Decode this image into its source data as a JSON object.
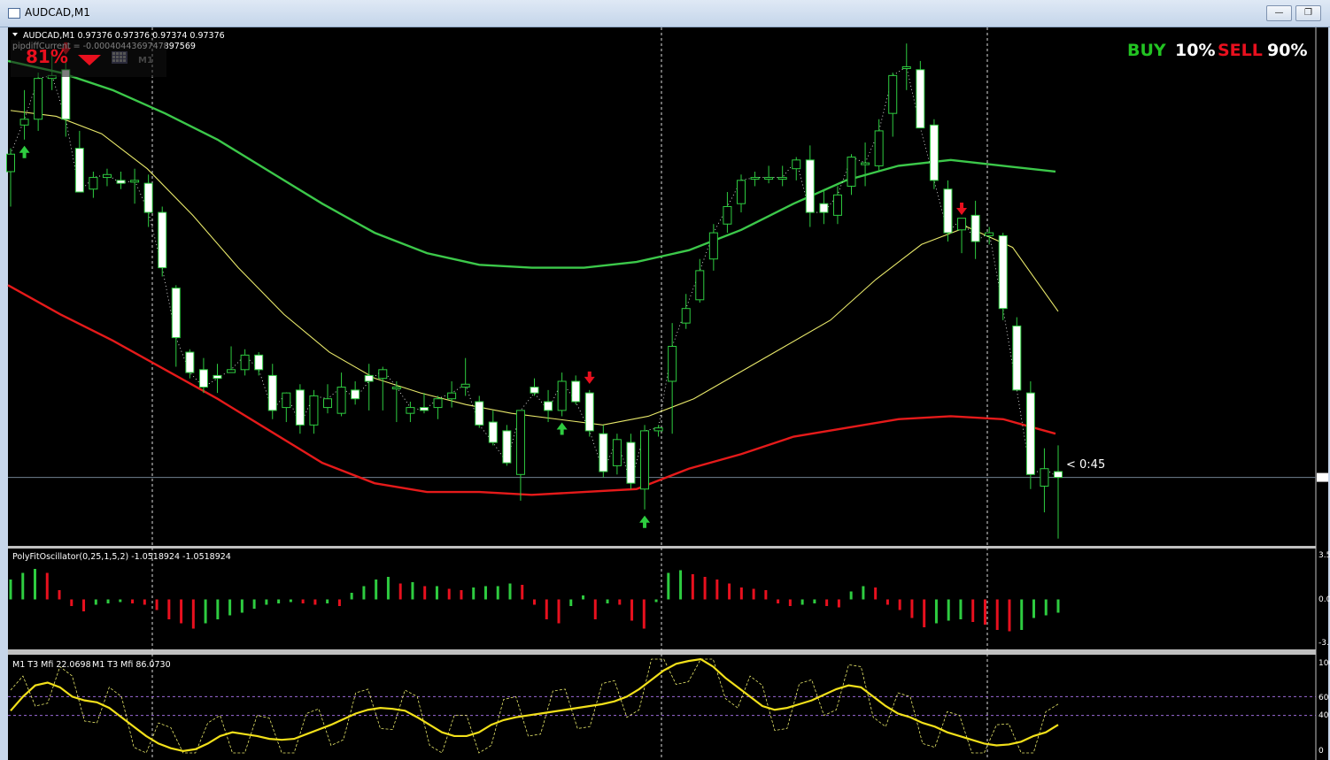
{
  "window": {
    "title": "AUDCAD,M1"
  },
  "main": {
    "info_line": "AUDCAD,M1  0.97376 0.97376 0.97374 0.97376",
    "pipdiff": "pipdiffCurrent = -0.0004044369747897569",
    "percent": "81%",
    "signal": {
      "buy_label": "BUY",
      "buy_value": "10%",
      "sell_label": "SELL",
      "sell_value": "90%"
    },
    "countdown": "< 0:45",
    "candles": [
      [
        0.9752,
        0.976,
        0.974,
        0.9758
      ],
      [
        0.9768,
        0.978,
        0.9763,
        0.977
      ],
      [
        0.977,
        0.9786,
        0.9766,
        0.9784
      ],
      [
        0.9784,
        0.9792,
        0.978,
        0.9785
      ],
      [
        0.9787,
        0.979,
        0.9764,
        0.977
      ],
      [
        0.976,
        0.9766,
        0.9746,
        0.9745
      ],
      [
        0.9746,
        0.9752,
        0.9743,
        0.975
      ],
      [
        0.975,
        0.9753,
        0.9747,
        0.9751
      ],
      [
        0.9749,
        0.9752,
        0.9746,
        0.9748
      ],
      [
        0.9749,
        0.9753,
        0.9741,
        0.9749
      ],
      [
        0.9748,
        0.9751,
        0.9733,
        0.9738
      ],
      [
        0.9738,
        0.974,
        0.9716,
        0.9719
      ],
      [
        0.9712,
        0.9713,
        0.9685,
        0.9695
      ],
      [
        0.969,
        0.9691,
        0.9681,
        0.9683
      ],
      [
        0.9684,
        0.9688,
        0.9676,
        0.9678
      ],
      [
        0.9682,
        0.9686,
        0.9676,
        0.9681
      ],
      [
        0.9683,
        0.9692,
        0.9683,
        0.9684
      ],
      [
        0.9684,
        0.9691,
        0.9682,
        0.9689
      ],
      [
        0.9689,
        0.969,
        0.9682,
        0.9684
      ],
      [
        0.9682,
        0.9686,
        0.9667,
        0.967
      ],
      [
        0.9671,
        0.9676,
        0.9666,
        0.9676
      ],
      [
        0.9677,
        0.9679,
        0.9662,
        0.9665
      ],
      [
        0.9665,
        0.9677,
        0.9662,
        0.9675
      ],
      [
        0.9671,
        0.9679,
        0.9669,
        0.9674
      ],
      [
        0.9669,
        0.9683,
        0.9668,
        0.9678
      ],
      [
        0.9677,
        0.968,
        0.9672,
        0.9674
      ],
      [
        0.9682,
        0.9686,
        0.967,
        0.968
      ],
      [
        0.9681,
        0.9685,
        0.967,
        0.9684
      ],
      [
        0.9678,
        0.968,
        0.9666,
        0.9678
      ],
      [
        0.9669,
        0.9673,
        0.9666,
        0.9671
      ],
      [
        0.9671,
        0.9676,
        0.9669,
        0.967
      ],
      [
        0.9671,
        0.9675,
        0.9667,
        0.9674
      ],
      [
        0.9674,
        0.968,
        0.9671,
        0.9676
      ],
      [
        0.9678,
        0.9688,
        0.9675,
        0.9679
      ],
      [
        0.9673,
        0.9675,
        0.9664,
        0.9665
      ],
      [
        0.9666,
        0.967,
        0.9658,
        0.9659
      ],
      [
        0.9663,
        0.9665,
        0.9651,
        0.9652
      ],
      [
        0.9648,
        0.9667,
        0.9639,
        0.967
      ],
      [
        0.9678,
        0.9681,
        0.9675,
        0.9676
      ],
      [
        0.9673,
        0.9677,
        0.9666,
        0.967
      ],
      [
        0.967,
        0.9683,
        0.9668,
        0.968
      ],
      [
        0.968,
        0.9682,
        0.9672,
        0.9673
      ],
      [
        0.9676,
        0.9677,
        0.9661,
        0.9663
      ],
      [
        0.9662,
        0.9665,
        0.9647,
        0.9649
      ],
      [
        0.9651,
        0.9662,
        0.9648,
        0.966
      ],
      [
        0.9659,
        0.9662,
        0.9643,
        0.9645
      ],
      [
        0.9643,
        0.9665,
        0.9636,
        0.9663
      ],
      [
        0.9663,
        0.9665,
        0.9661,
        0.9664
      ],
      [
        0.968,
        0.97,
        0.9662,
        0.9692
      ],
      [
        0.97,
        0.971,
        0.9698,
        0.9705
      ],
      [
        0.9708,
        0.9722,
        0.9707,
        0.9718
      ],
      [
        0.9722,
        0.9734,
        0.9718,
        0.9731
      ],
      [
        0.9734,
        0.9745,
        0.9731,
        0.974
      ],
      [
        0.9741,
        0.9751,
        0.9738,
        0.9749
      ],
      [
        0.975,
        0.9752,
        0.9747,
        0.975
      ],
      [
        0.975,
        0.9754,
        0.9748,
        0.975
      ],
      [
        0.975,
        0.9754,
        0.9747,
        0.975
      ],
      [
        0.9753,
        0.9757,
        0.9749,
        0.9756
      ],
      [
        0.9756,
        0.9761,
        0.9733,
        0.9738
      ],
      [
        0.9741,
        0.9746,
        0.9734,
        0.9738
      ],
      [
        0.9737,
        0.9747,
        0.9734,
        0.9744
      ],
      [
        0.9747,
        0.9758,
        0.9744,
        0.9757
      ],
      [
        0.9755,
        0.9762,
        0.9747,
        0.9755
      ],
      [
        0.9754,
        0.977,
        0.9752,
        0.9766
      ],
      [
        0.9772,
        0.9786,
        0.9764,
        0.9785
      ],
      [
        0.9788,
        0.9796,
        0.978,
        0.9788
      ],
      [
        0.9787,
        0.979,
        0.9767,
        0.9767
      ],
      [
        0.9768,
        0.977,
        0.9746,
        0.9749
      ],
      [
        0.9746,
        0.9749,
        0.9728,
        0.9731
      ],
      [
        0.9732,
        0.9735,
        0.9724,
        0.9736
      ],
      [
        0.9737,
        0.9742,
        0.9722,
        0.9728
      ],
      [
        0.973,
        0.9733,
        0.9727,
        0.9731
      ],
      [
        0.973,
        0.9731,
        0.9701,
        0.9705
      ],
      [
        0.9699,
        0.9702,
        0.9677,
        0.9677
      ],
      [
        0.9676,
        0.968,
        0.9643,
        0.9648
      ],
      [
        0.9644,
        0.9657,
        0.9635,
        0.965
      ],
      [
        0.9649,
        0.9658,
        0.9626,
        0.9647
      ]
    ],
    "ma_green": [
      0.979,
      0.9786,
      0.978,
      0.9772,
      0.9763,
      0.9752,
      0.9741,
      0.9731,
      0.9724,
      0.972,
      0.9719,
      0.9719,
      0.9721,
      0.9725,
      0.9732,
      0.9741,
      0.9749,
      0.9754,
      0.9756,
      0.9754,
      0.9752
    ],
    "ma_yellow": [
      0.9773,
      0.9771,
      0.9765,
      0.9753,
      0.9737,
      0.9719,
      0.9703,
      0.969,
      0.9681,
      0.9676,
      0.9672,
      0.9669,
      0.9667,
      0.9665,
      0.9668,
      0.9674,
      0.9683,
      0.9692,
      0.9701,
      0.9715,
      0.9727,
      0.9733,
      0.9726,
      0.9704
    ],
    "ma_red": [
      0.9713,
      0.9703,
      0.9694,
      0.9684,
      0.9674,
      0.9663,
      0.9652,
      0.9645,
      0.9642,
      0.9642,
      0.9641,
      0.9642,
      0.9643,
      0.965,
      0.9655,
      0.9661,
      0.9664,
      0.9667,
      0.9668,
      0.9667,
      0.9662
    ],
    "buy_arrow_index": [
      1,
      40,
      46
    ],
    "sell_arrow_index": [
      4,
      42,
      69
    ],
    "ylim": [
      0.9625,
      0.98
    ]
  },
  "oscillator": {
    "label": "PolyFitOscillator(0,25,1,5,2) -1.0518924 -1.0518924",
    "ticks": [
      "3.5",
      "0.0",
      "-3."
    ],
    "ylim": [
      -3.5,
      3.5
    ],
    "values": [
      1.5,
      2.0,
      2.3,
      2.0,
      0.7,
      -0.5,
      -0.9,
      -0.4,
      -0.3,
      -0.2,
      -0.3,
      -0.4,
      -0.8,
      -1.5,
      -1.8,
      -2.2,
      -1.8,
      -1.5,
      -1.2,
      -1.0,
      -0.7,
      -0.4,
      -0.3,
      -0.2,
      -0.3,
      -0.4,
      -0.3,
      -0.5,
      0.5,
      1.0,
      1.5,
      1.7,
      1.2,
      1.3,
      1.0,
      1.0,
      0.8,
      0.7,
      0.9,
      1.0,
      1.0,
      1.2,
      1.1,
      -0.4,
      -1.5,
      -1.8,
      -0.5,
      0.3,
      -1.5,
      -0.3,
      -0.4,
      -1.6,
      -2.2,
      -0.2,
      2.0,
      2.2,
      1.9,
      1.7,
      1.5,
      1.2,
      0.9,
      0.8,
      0.7,
      -0.3,
      -0.5,
      -0.4,
      -0.3,
      -0.5,
      -0.6,
      0.6,
      1.0,
      0.9,
      -0.4,
      -0.8,
      -1.4,
      -2.1,
      -1.8,
      -1.6,
      -1.5,
      -1.7,
      -1.9,
      -2.3,
      -2.4,
      -2.3,
      -1.4,
      -1.2,
      -1.0
    ]
  },
  "mfi": {
    "label_a": "M1  T3 Mfi  22.0698",
    "label_b": "M1  T3 Mfi  86.0730",
    "ticks": [
      "100",
      "60",
      "40",
      "0"
    ],
    "levels": [
      60,
      40
    ],
    "ylim": [
      0,
      100
    ],
    "t3": [
      45,
      60,
      72,
      75,
      70,
      60,
      56,
      54,
      48,
      38,
      28,
      18,
      10,
      5,
      2,
      4,
      10,
      18,
      22,
      20,
      18,
      15,
      14,
      15,
      20,
      25,
      30,
      36,
      42,
      46,
      48,
      47,
      45,
      38,
      30,
      22,
      18,
      18,
      22,
      30,
      35,
      38,
      40,
      42,
      44,
      46,
      48,
      50,
      52,
      55,
      60,
      68,
      78,
      88,
      95,
      98,
      100,
      92,
      80,
      70,
      60,
      50,
      46,
      48,
      52,
      56,
      62,
      68,
      72,
      70,
      60,
      50,
      42,
      38,
      32,
      28,
      22,
      18,
      14,
      10,
      8,
      9,
      12,
      18,
      22,
      30
    ]
  }
}
